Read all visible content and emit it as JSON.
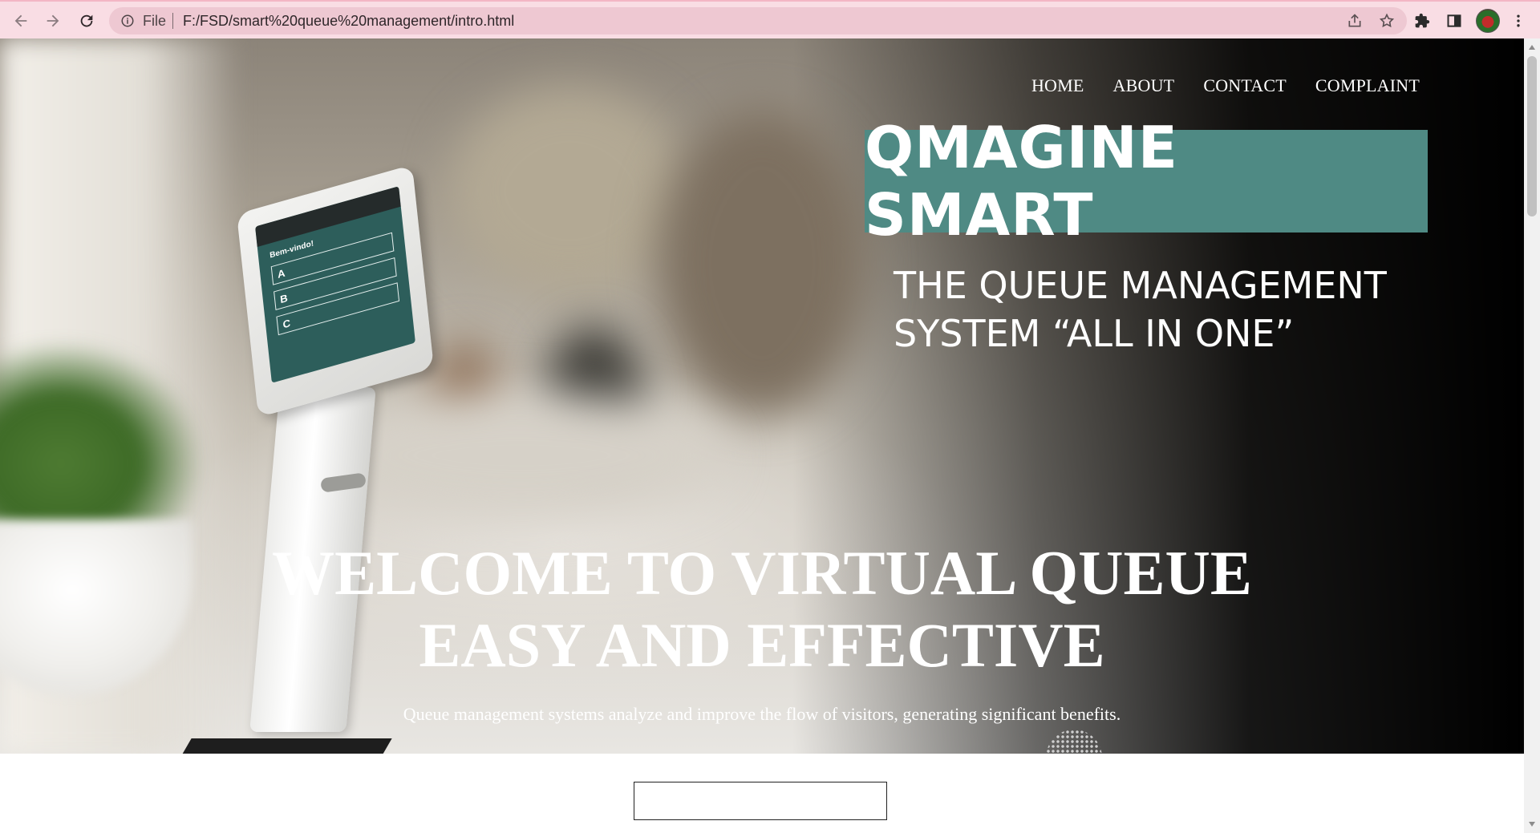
{
  "browser": {
    "file_label": "File",
    "url": "F:/FSD/smart%20queue%20management/intro.html",
    "icons": [
      "back-arrow-icon",
      "forward-arrow-icon",
      "reload-icon",
      "info-icon",
      "share-icon",
      "star-icon",
      "extensions-icon",
      "side-panel-icon",
      "profile-avatar",
      "more-menu-icon"
    ]
  },
  "nav": {
    "home": "HOME",
    "about": "ABOUT",
    "contact": "CONTACT",
    "complaint": "COMPLAINT"
  },
  "hero": {
    "brand": "QMAGINE SMART",
    "tagline": "THE QUEUE MANAGEMENT\nSYSTEM “ALL IN ONE”",
    "headline_line1": "WELCOME TO VIRTUAL QUEUE",
    "headline_line2": "EASY AND EFFECTIVE",
    "subtext": "Queue management systems analyze and improve the flow of visitors, generating significant benefits.",
    "kiosk_screen": {
      "greeting": "Bem-vindo!",
      "options": [
        "A",
        "B",
        "C"
      ]
    }
  },
  "colors": {
    "brand_box": "#4f8a84",
    "browser_chrome": "#f9dde4",
    "omnibox": "#eec8d2"
  }
}
